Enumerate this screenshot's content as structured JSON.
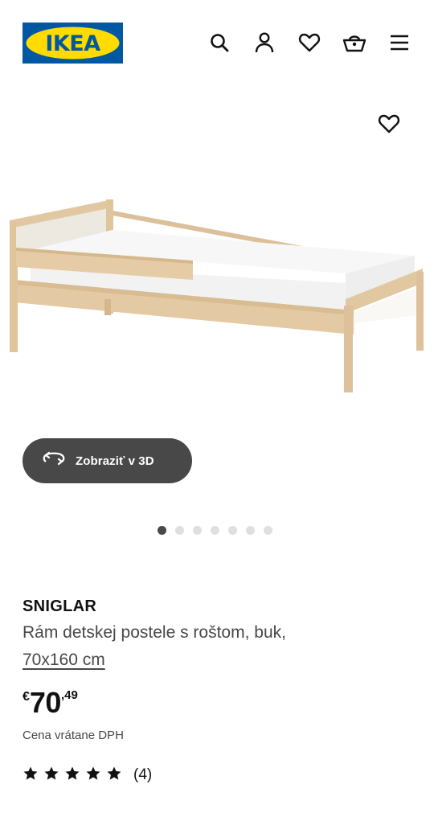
{
  "header": {
    "logo_text": "IKEA",
    "brand_colors": {
      "blue": "#0058a3",
      "yellow": "#ffdb00"
    },
    "icons": [
      "search-icon",
      "account-icon",
      "heart-icon",
      "basket-icon",
      "menu-icon"
    ]
  },
  "gallery": {
    "favorite_icon": "heart-icon",
    "view_3d_label": "Zobraziť v 3D",
    "view_3d_icon": "rotate-3d-icon",
    "image_count": 7,
    "active_index": 0
  },
  "product": {
    "name": "SNIGLAR",
    "description": "Rám detskej postele s roštom, buk,",
    "size": "70x160 cm",
    "price": {
      "currency": "€",
      "integer": "70",
      "decimal": ",49"
    },
    "vat_note": "Cena vrátane DPH",
    "rating": {
      "stars": 5,
      "max": 5,
      "reviews": "(4)"
    }
  }
}
